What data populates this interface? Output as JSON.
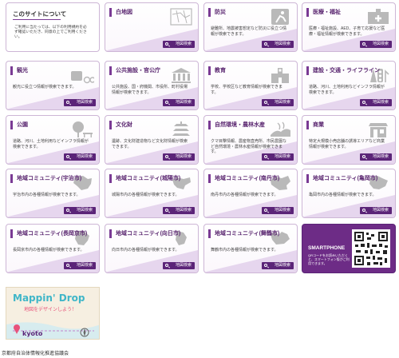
{
  "about": {
    "title": "このサイトについて",
    "text": "ご利用に当たっては、以下の利用規約を必ず確認いただき、同意の上でご利用ください。"
  },
  "button_label": "地図検索",
  "tiles": [
    {
      "title": "白地図",
      "desc": "",
      "icon": "blank-map-icon"
    },
    {
      "title": "防災",
      "desc": "避難所、地震被害想定など防災に役立つ情報が検索できます。",
      "icon": "disaster-prevention-icon"
    },
    {
      "title": "医療・福祉",
      "desc": "医療・福祉施設、AED、子育て応援など医療・福祉情報が検索できます。",
      "icon": "medical-icon"
    },
    {
      "title": "観光",
      "desc": "観光に役立つ情報が検索できます。",
      "icon": "tourism-icon"
    },
    {
      "title": "公共施設・官公庁",
      "desc": "公共施設、国・府機関、市役所、町村役場情報が検索できます。",
      "icon": "public-building-icon"
    },
    {
      "title": "教育",
      "desc": "学校、学校区など教育情報が検索できます。",
      "icon": "education-icon"
    },
    {
      "title": "建設・交通・ライフライン",
      "desc": "道路、河川、土地利用などインフラ情報が検索できます。",
      "icon": "traffic-icon"
    },
    {
      "title": "公園",
      "desc": "道路、河川、土地利用などインフラ情報が検索できます。",
      "icon": "park-icon"
    },
    {
      "title": "文化財",
      "desc": "遺跡、文化財建造物など文化財情報が検索できます。",
      "icon": "cultural-property-icon"
    },
    {
      "title": "自然環境・農林水産",
      "desc": "クマ目撃情報、農産物直売所、市民農園など自然環境・農林水産情報が検索できます。",
      "icon": "agriculture-icon"
    },
    {
      "title": "商業",
      "desc": "特定大規模小売店舗の誘導エリアなど商業情報が検索できます。",
      "icon": "commerce-icon"
    },
    {
      "title": "地域コミュニティ(宇治市)",
      "desc": "宇治市内の各種情報が検索できます。",
      "icon": "uji-map-icon"
    },
    {
      "title": "地域コミュニティ(城陽市)",
      "desc": "城陽市内の各種情報が検索できます。",
      "icon": "joyo-map-icon"
    },
    {
      "title": "地域コミュニティ(南丹市)",
      "desc": "南丹市内の各種情報が検索できます。",
      "icon": "nantan-map-icon"
    },
    {
      "title": "地域コミュニティ(亀岡市)",
      "desc": "亀岡市内の各種情報が検索できます。",
      "icon": "kameoka-map-icon"
    },
    {
      "title": "地域コミュニティ(長岡京市)",
      "desc": "長岡京市内の各種情報が検索できます。",
      "icon": "nagaokakyo-map-icon"
    },
    {
      "title": "地域コミュニティ(向日市)",
      "desc": "向日市内の各種情報が検索できます。",
      "icon": "muko-map-icon"
    },
    {
      "title": "地域コミュニティ(舞鶴市)",
      "desc": "舞鶴市内の各種情報が検索できます。",
      "icon": "maizuru-map-icon"
    }
  ],
  "smartphone": {
    "title": "SMARTPHONE",
    "text": "QRコードをお読みいただくと、スマートフォン版がご利用できます。"
  },
  "banner": {
    "title": "Mappin' Drop",
    "subtitle": "地図をデザインしよう！",
    "brand": "kyoto"
  },
  "footer": "京都府自治体情報化推進協議会",
  "colors": {
    "accent": "#5b2478",
    "border": "#cdb6d6",
    "deco": "#e6d6ee"
  }
}
